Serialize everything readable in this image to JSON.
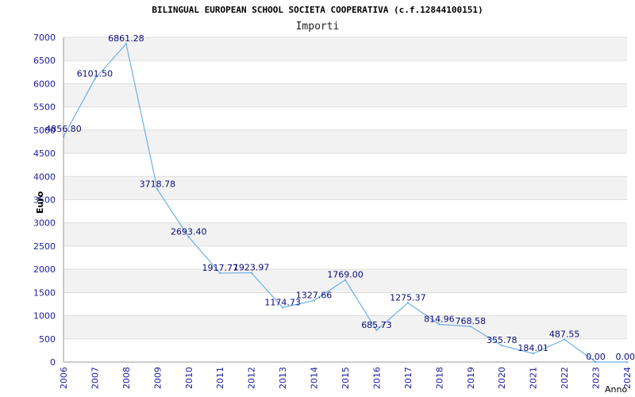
{
  "chart_data": {
    "type": "line",
    "title": "BILINGUAL EUROPEAN SCHOOL SOCIETA COOPERATIVA (c.f.12844100151)",
    "subtitle": "Importi",
    "ylabel": "Euro",
    "xlabel": "Anno",
    "x": [
      "2006",
      "2007",
      "2008",
      "2009",
      "2010",
      "2011",
      "2012",
      "2013",
      "2014",
      "2015",
      "2016",
      "2017",
      "2018",
      "2019",
      "2020",
      "2021",
      "2022",
      "2023",
      "2024"
    ],
    "series": [
      {
        "values": [
          4856.8,
          6101.5,
          6861.28,
          3718.78,
          2693.4,
          1917.77,
          1923.97,
          1174.73,
          1327.66,
          1769.0,
          685.73,
          1275.37,
          814.96,
          768.58,
          355.78,
          184.01,
          487.55,
          0.0,
          0.0
        ],
        "labels": [
          "4856.80",
          "6101.50",
          "6861.28",
          "3718.78",
          "2693.40",
          "1917.77",
          "1923.97",
          "1174.73",
          "1327.66",
          "1769.00",
          "685.73",
          "1275.37",
          "814.96",
          "768.58",
          "355.78",
          "184.01",
          "487.55",
          "0.00",
          "0.00"
        ]
      }
    ],
    "yticks": [
      "0",
      "500",
      "1000",
      "1500",
      "2000",
      "2500",
      "3000",
      "3500",
      "4000",
      "4500",
      "5000",
      "5500",
      "6000",
      "6500",
      "7000"
    ],
    "ylim": [
      0,
      7000
    ],
    "grid": true,
    "band_colors": [
      "#f2f2f2",
      "#ffffff"
    ],
    "line_color": "#6ab0e8",
    "tick_color": "#1a1aa0",
    "label_color": "#0a0a7a"
  }
}
